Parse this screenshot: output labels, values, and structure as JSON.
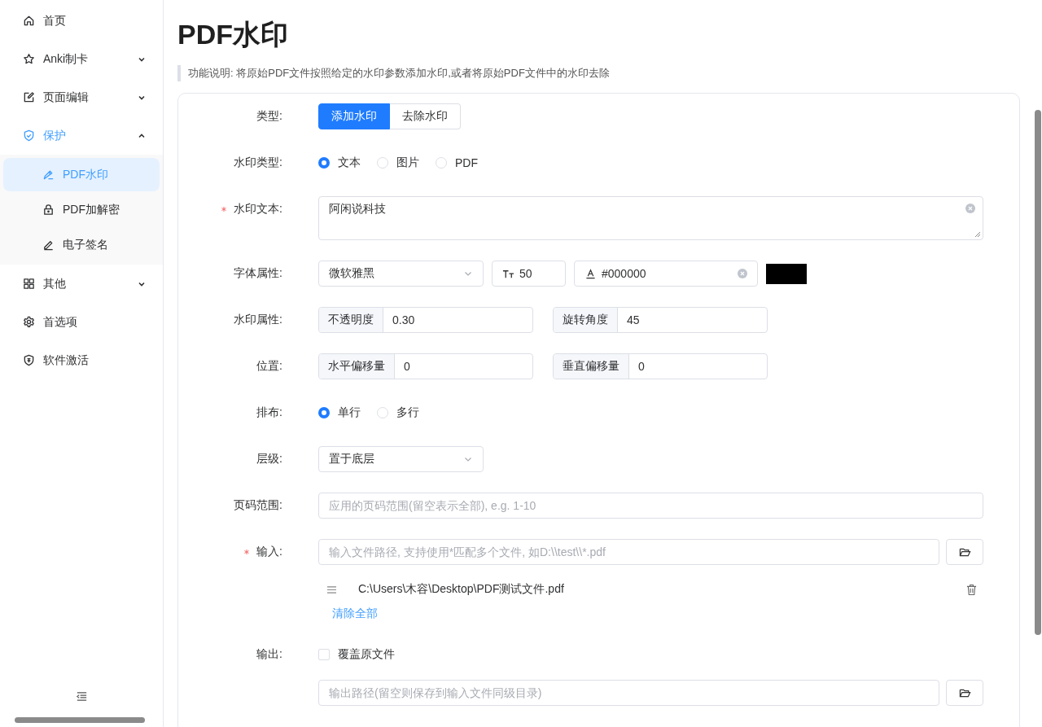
{
  "sidebar": {
    "items": [
      {
        "label": "首页",
        "selected": false
      },
      {
        "label": "Anki制卡",
        "selected": false,
        "expanded": false
      },
      {
        "label": "页面编辑",
        "selected": false,
        "expanded": false
      },
      {
        "label": "保护",
        "selected": true,
        "expanded": true,
        "children": [
          {
            "label": "PDF水印",
            "selected": true
          },
          {
            "label": "PDF加解密",
            "selected": false
          },
          {
            "label": "电子签名",
            "selected": false
          }
        ]
      },
      {
        "label": "其他",
        "selected": false,
        "expanded": false
      },
      {
        "label": "首选项",
        "selected": false
      },
      {
        "label": "软件激活",
        "selected": false
      }
    ]
  },
  "page": {
    "title": "PDF水印",
    "description": "功能说明: 将原始PDF文件按照给定的水印参数添加水印,或者将原始PDF文件中的水印去除"
  },
  "form": {
    "rows": [
      {
        "kind": "toggle",
        "label": "类型:",
        "required": false,
        "options": [
          {
            "label": "添加水印",
            "selected": true
          },
          {
            "label": "去除水印",
            "selected": false
          }
        ]
      },
      {
        "kind": "radio",
        "label": "水印类型:",
        "required": false,
        "options": [
          {
            "label": "文本",
            "selected": true
          },
          {
            "label": "图片",
            "selected": false
          },
          {
            "label": "PDF",
            "selected": false
          }
        ]
      },
      {
        "kind": "textarea",
        "label": "水印文本:",
        "required": true,
        "value": "阿闲说科技"
      },
      {
        "kind": "font",
        "label": "字体属性:",
        "required": false,
        "family": "微软雅黑",
        "size": "50",
        "color_value": "#000000"
      },
      {
        "kind": "pair",
        "label": "水印属性:",
        "required": false,
        "fields": [
          {
            "prefix": "不透明度",
            "value": "0.30"
          },
          {
            "prefix": "旋转角度",
            "value": "45"
          }
        ]
      },
      {
        "kind": "pair",
        "label": "位置:",
        "required": false,
        "fields": [
          {
            "prefix": "水平偏移量",
            "value": "0"
          },
          {
            "prefix": "垂直偏移量",
            "value": "0"
          }
        ]
      },
      {
        "kind": "radio",
        "label": "排布:",
        "required": false,
        "options": [
          {
            "label": "单行",
            "selected": true
          },
          {
            "label": "多行",
            "selected": false
          }
        ]
      },
      {
        "kind": "select",
        "label": "层级:",
        "required": false,
        "value": "置于底层"
      },
      {
        "kind": "text",
        "label": "页码范围:",
        "required": false,
        "placeholder": "应用的页码范围(留空表示全部), e.g. 1-10"
      },
      {
        "kind": "file",
        "label": "输入:",
        "required": true,
        "placeholder": "输入文件路径, 支持使用*匹配多个文件, 如D:\\\\test\\\\*.pdf",
        "files": [
          "C:\\Users\\木容\\Desktop\\PDF测试文件.pdf"
        ],
        "clear_label": "清除全部"
      },
      {
        "kind": "output",
        "label": "输出:",
        "required": false,
        "checkbox": {
          "label": "覆盖原文件",
          "checked": false
        },
        "placeholder": "输出路径(留空则保存到输入文件同级目录)"
      }
    ]
  }
}
